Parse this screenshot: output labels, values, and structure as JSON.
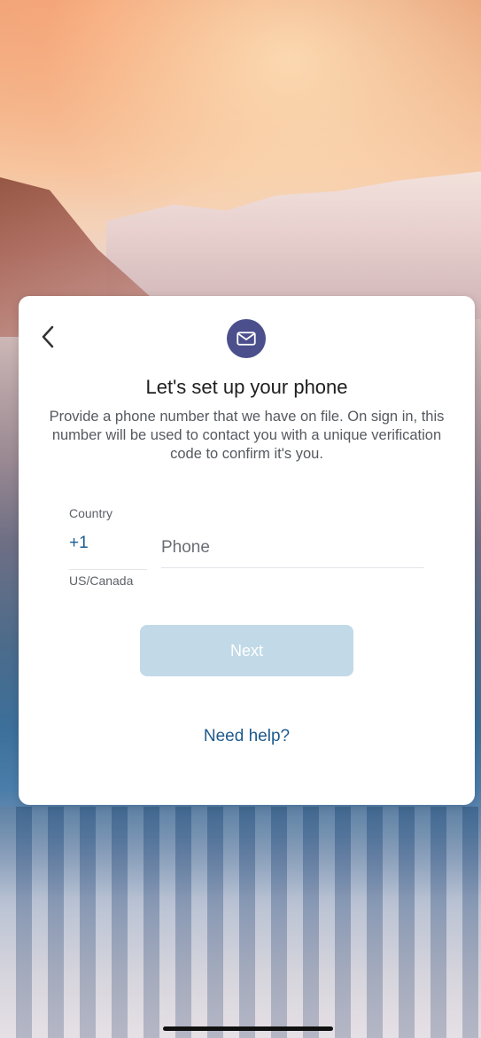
{
  "card": {
    "title": "Let's set up your phone",
    "description": "Provide a phone number that we have on file. On sign in, this number will be used to contact you with a unique verification code to confirm it's you.",
    "back_icon": "chevron-left-icon",
    "header_icon": "mail-icon"
  },
  "form": {
    "country_label": "Country",
    "country_code": "+1",
    "country_name": "US/Canada",
    "phone_placeholder": "Phone",
    "phone_value": ""
  },
  "actions": {
    "next_label": "Next",
    "help_label": "Need help?"
  },
  "colors": {
    "accent": "#1e5a8c",
    "badge": "#4b4f8c",
    "button_disabled": "#c2d9e8"
  }
}
